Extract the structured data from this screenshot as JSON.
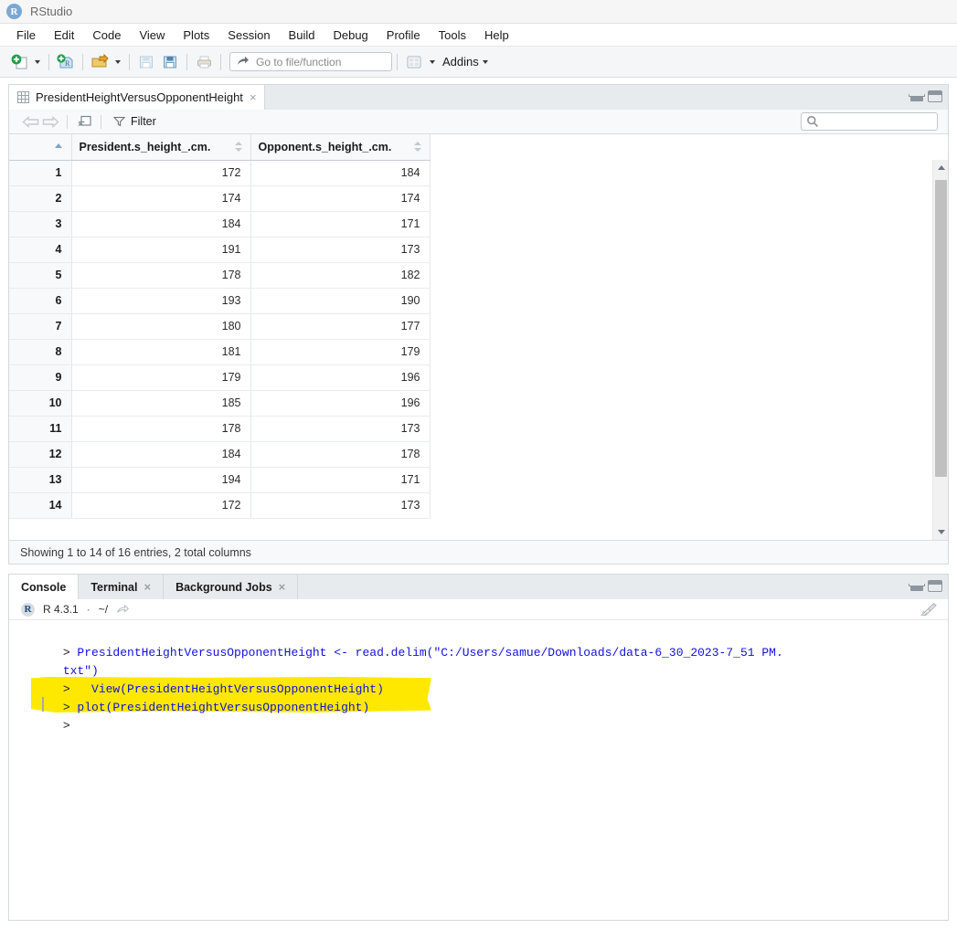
{
  "titlebar": {
    "app_name": "RStudio",
    "logo_letter": "R"
  },
  "menubar": {
    "items": [
      {
        "label": "File"
      },
      {
        "label": "Edit"
      },
      {
        "label": "Code"
      },
      {
        "label": "View"
      },
      {
        "label": "Plots"
      },
      {
        "label": "Session"
      },
      {
        "label": "Build"
      },
      {
        "label": "Debug"
      },
      {
        "label": "Profile"
      },
      {
        "label": "Tools"
      },
      {
        "label": "Help"
      }
    ]
  },
  "toolbar": {
    "new_file_icon": "new-file-icon",
    "new_project_icon": "new-project-icon",
    "open_file_icon": "open-file-icon",
    "save_icon": "save-icon",
    "save_all_icon": "save-all-icon",
    "print_icon": "print-icon",
    "goto_file_placeholder": "Go to file/function",
    "goto_file_value": "",
    "workspace_panes_icon": "workspace-panes-icon",
    "addins_label": "Addins"
  },
  "source_pane": {
    "tab": {
      "label": "PresidentHeightVersusOpponentHeight",
      "close": "×"
    },
    "view_toolbar": {
      "back_icon": "back-arrow-icon",
      "forward_icon": "forward-arrow-icon",
      "popout_icon": "show-in-new-window-icon",
      "filter_label": "Filter",
      "search_placeholder": "",
      "search_value": ""
    },
    "minimize_icon": "minimize-icon",
    "maximize_icon": "maximize-icon",
    "status": "Showing 1 to 14 of 16 entries, 2 total columns"
  },
  "grid": {
    "columns": [
      {
        "label": "",
        "sort": "asc"
      },
      {
        "label": "President.s_height_.cm.",
        "sort": "none"
      },
      {
        "label": "Opponent.s_height_.cm.",
        "sort": "none"
      }
    ],
    "rows": [
      {
        "n": "1",
        "president": "172",
        "opponent": "184"
      },
      {
        "n": "2",
        "president": "174",
        "opponent": "174"
      },
      {
        "n": "3",
        "president": "184",
        "opponent": "171"
      },
      {
        "n": "4",
        "president": "191",
        "opponent": "173"
      },
      {
        "n": "5",
        "president": "178",
        "opponent": "182"
      },
      {
        "n": "6",
        "president": "193",
        "opponent": "190"
      },
      {
        "n": "7",
        "president": "180",
        "opponent": "177"
      },
      {
        "n": "8",
        "president": "181",
        "opponent": "179"
      },
      {
        "n": "9",
        "president": "179",
        "opponent": "196"
      },
      {
        "n": "10",
        "president": "185",
        "opponent": "196"
      },
      {
        "n": "11",
        "president": "178",
        "opponent": "173"
      },
      {
        "n": "12",
        "president": "184",
        "opponent": "178"
      },
      {
        "n": "13",
        "president": "194",
        "opponent": "171"
      },
      {
        "n": "14",
        "president": "172",
        "opponent": "173"
      }
    ]
  },
  "console_pane": {
    "tabs": [
      {
        "label": "Console",
        "active": true,
        "closable": false
      },
      {
        "label": "Terminal",
        "active": false,
        "closable": true,
        "close": "×"
      },
      {
        "label": "Background Jobs",
        "active": false,
        "closable": true,
        "close": "×"
      }
    ],
    "r_badge": "R",
    "r_version": "R 4.3.1",
    "separator": "·",
    "working_dir": "~/",
    "popout_icon": "open-in-window-icon",
    "clear_console_icon": "broom-icon",
    "minimize_icon": "minimize-icon",
    "maximize_icon": "maximize-icon",
    "lines": [
      {
        "prompt": "> ",
        "text": "PresidentHeightVersusOpponentHeight <- read.delim(\"C:/Users/samue/Downloads/data-6_30_2023-7_51 PM."
      },
      {
        "prompt": "",
        "text": "txt\")"
      },
      {
        "prompt": ">   ",
        "text": "View(PresidentHeightVersusOpponentHeight)"
      },
      {
        "prompt": "> ",
        "text": "plot(PresidentHeightVersusOpponentHeight)"
      },
      {
        "prompt": "> ",
        "text": ""
      }
    ],
    "highlight_color": "#ffe800"
  },
  "colors": {
    "accent": "#1111dd",
    "highlight": "#ffe800",
    "pane_border": "#d5d9dd",
    "tab_strip": "#e8ebed"
  }
}
